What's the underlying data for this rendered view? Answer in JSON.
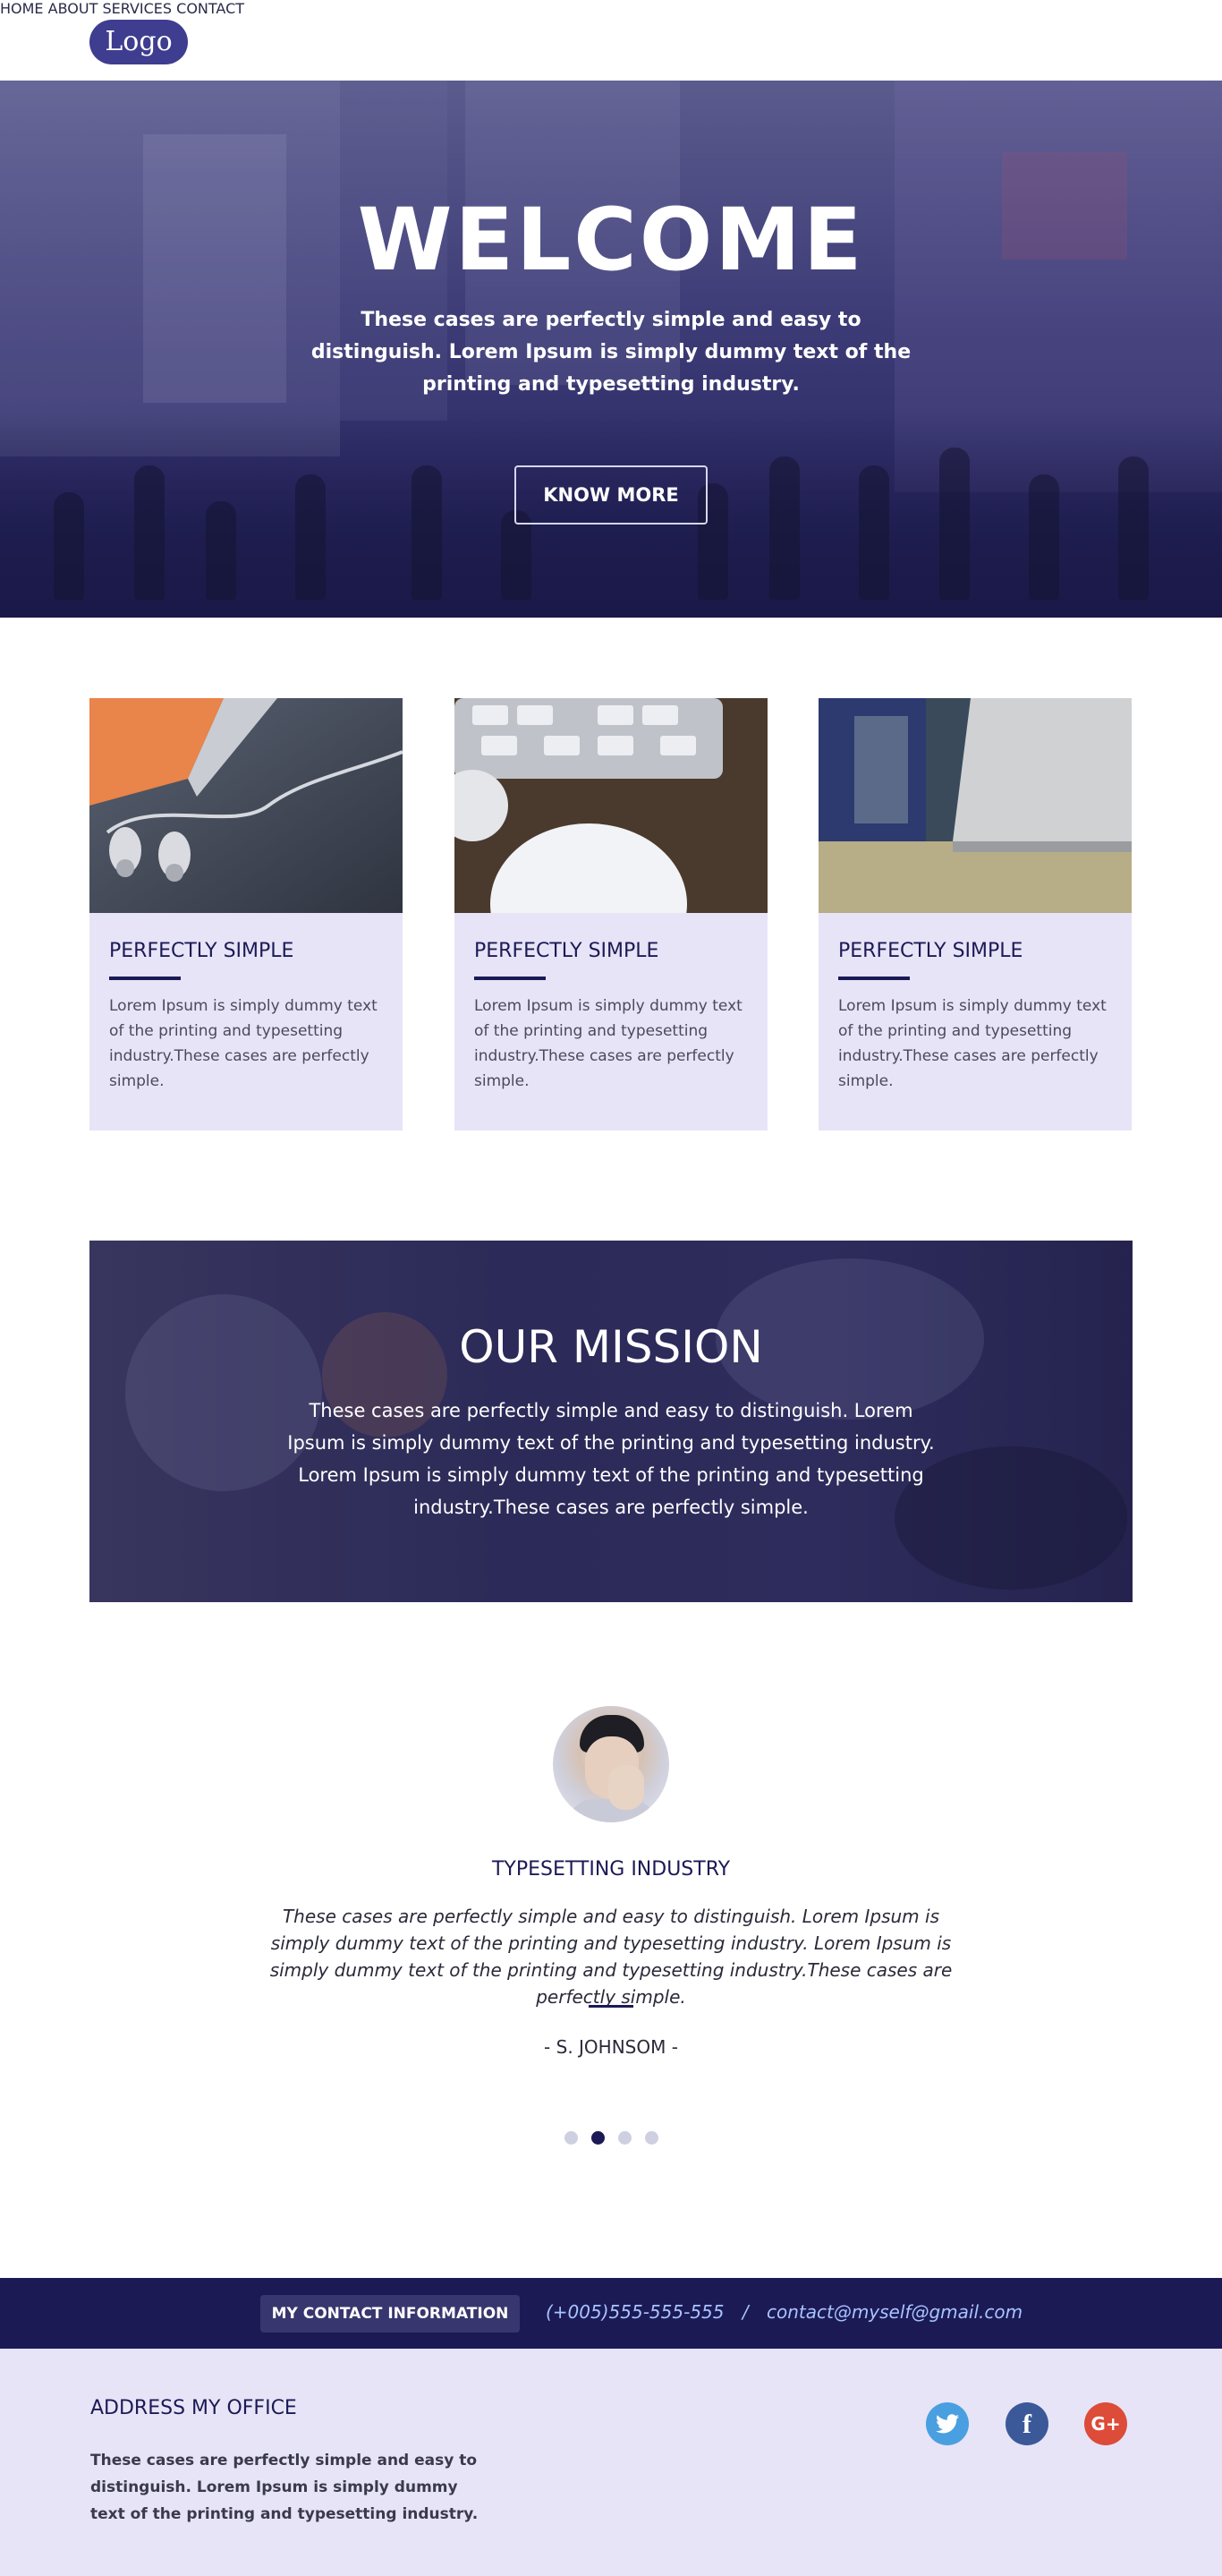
{
  "header": {
    "logo": "Logo",
    "nav": [
      "HOME",
      "ABOUT",
      "SERVICES",
      "CONTACT"
    ]
  },
  "hero": {
    "title": "WELCOME",
    "text": "These cases are perfectly simple and easy to distinguish. Lorem Ipsum is simply dummy text of the printing and typesetting industry.",
    "button": "KNOW MORE"
  },
  "cards": [
    {
      "image": "headphones-on-desk-image",
      "title": "PERFECTLY SIMPLE",
      "text": "Lorem Ipsum is simply dummy text of the printing and typesetting industry.These cases are perfectly simple."
    },
    {
      "image": "keyboard-and-mouse-image",
      "title": "PERFECTLY SIMPLE",
      "text": "Lorem Ipsum is simply dummy text of the printing and typesetting industry.These cases are perfectly simple."
    },
    {
      "image": "laptop-on-table-image",
      "title": "PERFECTLY SIMPLE",
      "text": "Lorem Ipsum is simply dummy text of the printing and typesetting industry.These cases are perfectly simple."
    }
  ],
  "mission": {
    "title": "OUR MISSION",
    "text": "These cases are perfectly simple and easy to distinguish. Lorem Ipsum is simply dummy text of the printing and typesetting industry. Lorem Ipsum is simply dummy text of the printing and typesetting industry.These cases are perfectly simple."
  },
  "testimonial": {
    "title": "TYPESETTING INDUSTRY",
    "quote": "These cases are perfectly simple and easy to distinguish. Lorem Ipsum is simply dummy text of the printing and typesetting industry. Lorem Ipsum is simply dummy text of the printing and typesetting industry.These cases are perfectly simple.",
    "author": "- S. JOHNSOM -",
    "slide_count": 4,
    "active_slide": 2
  },
  "contact": {
    "label": "MY CONTACT INFORMATION",
    "phone": "(+005)555-555-555",
    "separator": "/",
    "email": "contact@myself@gmail.com"
  },
  "footer": {
    "title": "ADDRESS MY OFFICE",
    "text": "These cases are perfectly simple and easy to distinguish. Lorem Ipsum is simply dummy text of the printing and typesetting industry.",
    "social": [
      "twitter-icon",
      "facebook-icon",
      "google-plus-icon"
    ]
  },
  "colors": {
    "primary": "#1c1a55",
    "logo_bg": "#3f3d8f",
    "card_bg": "#e7e4f7",
    "contact_link": "#a8c4ff"
  }
}
